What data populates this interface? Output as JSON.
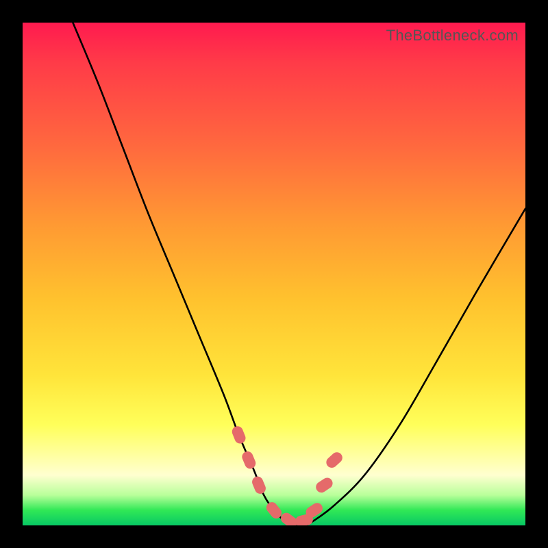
{
  "attribution": "TheBottleneck.com",
  "chart_data": {
    "type": "line",
    "title": "",
    "xlabel": "",
    "ylabel": "",
    "xlim": [
      0,
      100
    ],
    "ylim": [
      0,
      100
    ],
    "x": [
      10,
      15,
      20,
      25,
      30,
      35,
      40,
      43,
      46,
      48,
      50,
      52,
      54,
      56,
      58,
      62,
      68,
      75,
      82,
      90,
      100
    ],
    "series": [
      {
        "name": "bottleneck-curve",
        "values": [
          100,
          88,
          75,
          62,
          50,
          38,
          26,
          18,
          11,
          6,
          3,
          1,
          0,
          0,
          1,
          4,
          10,
          20,
          32,
          46,
          63
        ]
      }
    ],
    "markers": {
      "x": [
        43,
        45,
        47,
        50,
        53,
        56,
        58,
        60,
        62
      ],
      "y": [
        18,
        13,
        8,
        3,
        1,
        1,
        3,
        8,
        13
      ],
      "color": "#e56a6a"
    },
    "colors": {
      "gradient_top": "#ff1a4f",
      "gradient_mid": "#ffe43a",
      "gradient_bottom": "#08c864",
      "curve": "#000000",
      "marker": "#e56a6a",
      "frame": "#000000"
    }
  }
}
